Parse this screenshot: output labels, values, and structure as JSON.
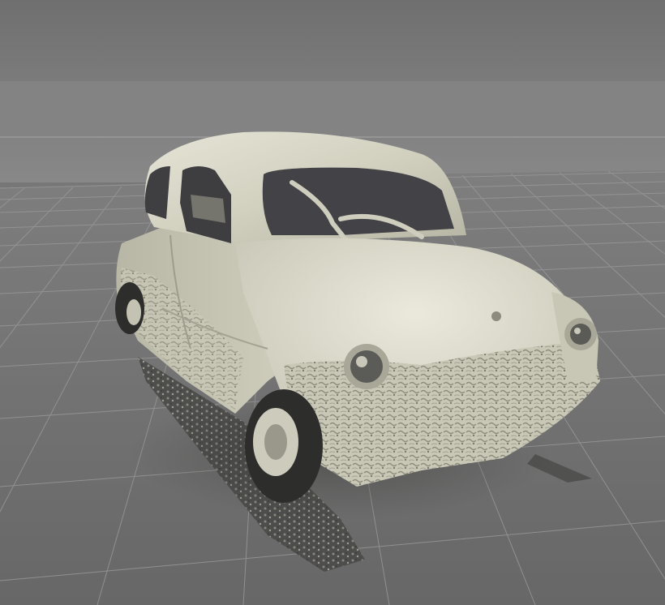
{
  "viewport": {
    "background_colors": {
      "sky_top": "#6f6f6f",
      "sky_mid": "#808080",
      "horizon_band": "#8a8a8a",
      "floor_far": "#7d7d7d",
      "floor_near": "#6a6a6a",
      "grid_line": "#9a9a9a"
    },
    "model": {
      "subject": "scanned-car-mesh",
      "body_color": "#d7d5c4",
      "shadow_color": "#3c3c38",
      "window_color": "#4a4a4c"
    }
  }
}
